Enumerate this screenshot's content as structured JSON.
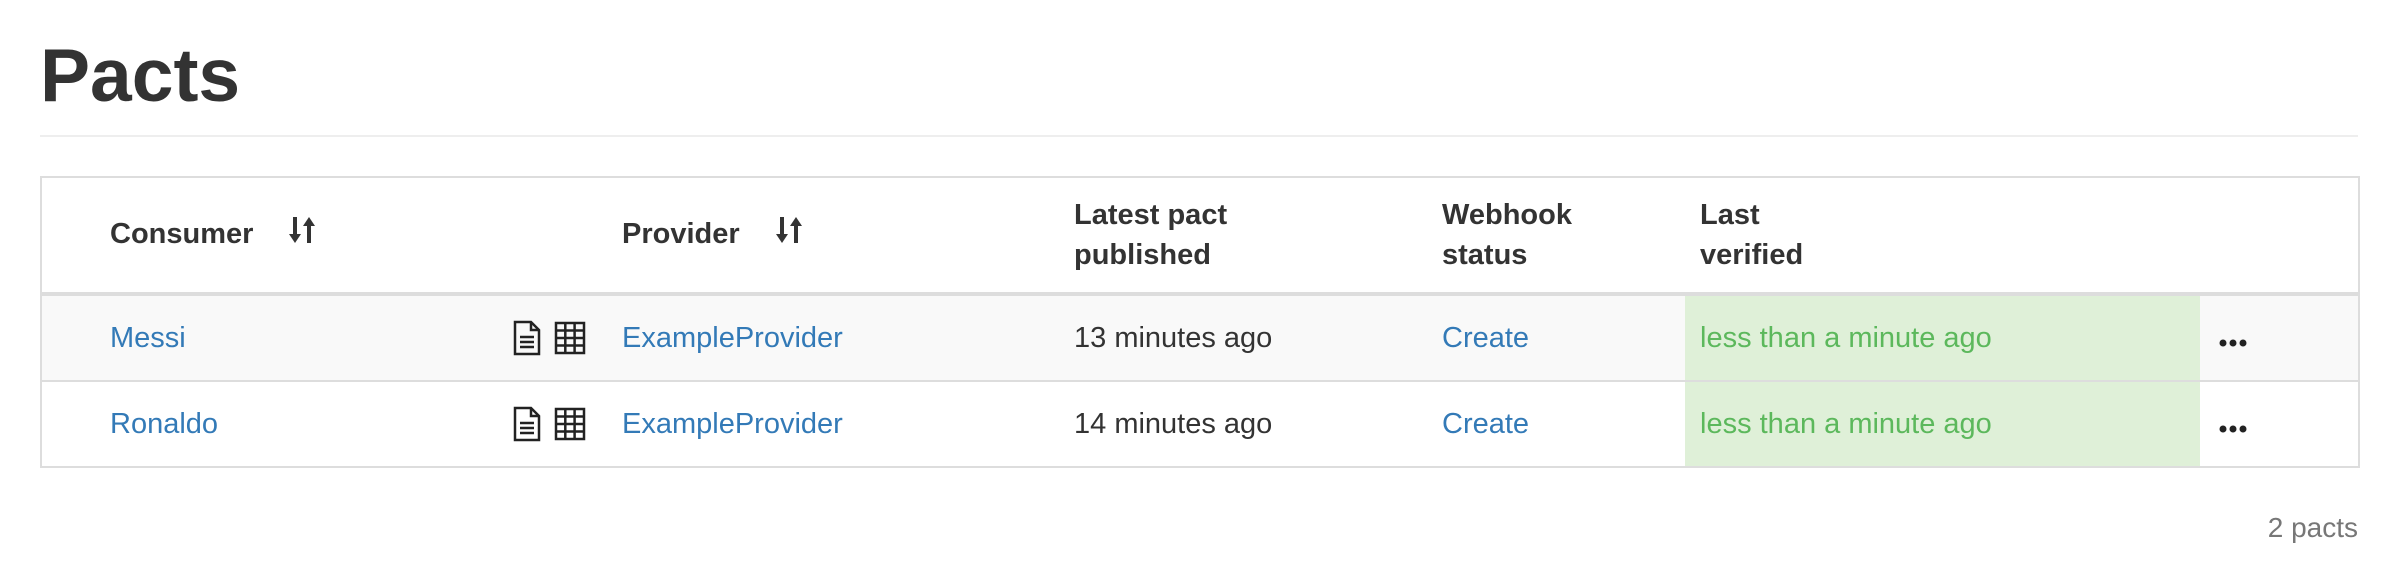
{
  "page": {
    "title": "Pacts"
  },
  "table": {
    "headers": {
      "consumer": "Consumer",
      "provider": "Provider",
      "latest_pact_line1": "Latest pact",
      "latest_pact_line2": "published",
      "webhook_line1": "Webhook",
      "webhook_line2": "status",
      "last_verified_line1": "Last",
      "last_verified_line2": "verified"
    },
    "rows": [
      {
        "consumer": "Messi",
        "provider": "ExampleProvider",
        "latest_published": "13 minutes ago",
        "webhook_status": "Create",
        "last_verified": "less than a minute ago"
      },
      {
        "consumer": "Ronaldo",
        "provider": "ExampleProvider",
        "latest_published": "14 minutes ago",
        "webhook_status": "Create",
        "last_verified": "less than a minute ago"
      }
    ]
  },
  "footer": {
    "count": "2 pacts"
  },
  "icons": {
    "sort": "sort-icon",
    "document": "document-icon",
    "matrix": "matrix-grid-icon",
    "more": "ellipsis-icon"
  },
  "colors": {
    "link": "#337ab7",
    "verified_bg": "#dff0d8",
    "verified_text": "#5cb85c",
    "border": "#dddddd"
  }
}
